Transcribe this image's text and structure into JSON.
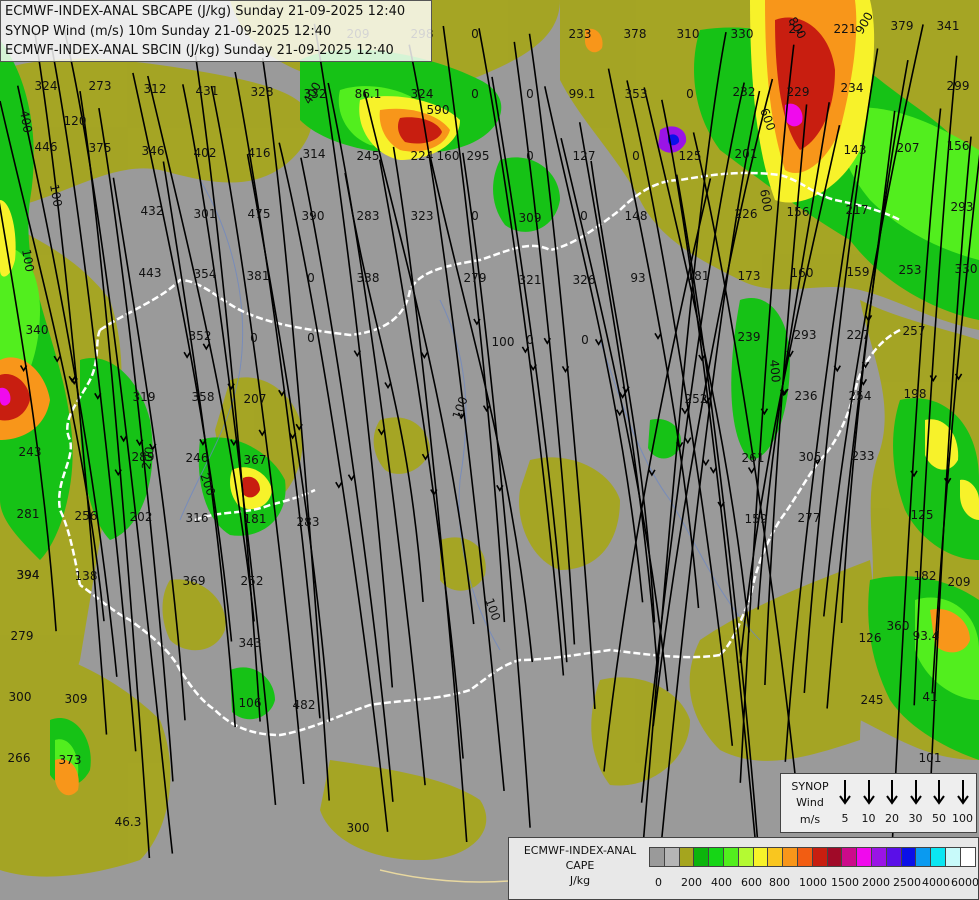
{
  "header": {
    "line1": "ECMWF-INDEX-ANAL SBCAPE (J/kg) Sunday 21-09-2025 12:40",
    "line2": "SYNOP Wind (m/s) 10m Sunday 21-09-2025 12:40",
    "line3": "ECMWF-INDEX-ANAL SBCIN (J/kg) Sunday 21-09-2025 12:40"
  },
  "synop_legend": {
    "title": "SYNOP",
    "subtitle": "Wind",
    "unit": "m/s",
    "speeds": [
      "5",
      "10",
      "20",
      "30",
      "50",
      "100"
    ]
  },
  "cape_legend": {
    "title": "ECMWF-INDEX-ANAL",
    "subtitle": "CAPE",
    "unit": "J/kg",
    "colors": [
      "#9a9a9a",
      "#b5b5b5",
      "#a5a51e",
      "#0cb40c",
      "#16d616",
      "#52ee1e",
      "#b4fa32",
      "#f7f22a",
      "#f9c61f",
      "#f8961a",
      "#f25d12",
      "#c81e10",
      "#a00a28",
      "#cc0a8a",
      "#f00aed",
      "#9a14e6",
      "#5a0fe8",
      "#0a10e8",
      "#0a9af0",
      "#0ae6f2",
      "#c8fafa",
      "#ffffff"
    ],
    "tick_labels": [
      "0",
      "200",
      "400",
      "600",
      "800",
      "1000",
      "1500",
      "2000",
      "2500",
      "4000",
      "6000"
    ]
  },
  "map": {
    "cin_values": [
      "209",
      "298",
      "0",
      "233",
      "378",
      "310",
      "330",
      "22",
      "221",
      "379",
      "341",
      "324",
      "273",
      "312",
      "431",
      "328",
      "332",
      "86.1",
      "324",
      "0",
      "0",
      "99.1",
      "353",
      "0",
      "232",
      "229",
      "234",
      "299",
      "120",
      "590",
      "143",
      "207",
      "156",
      "446",
      "375",
      "346",
      "402",
      "416",
      "314",
      "245",
      "224",
      "160",
      "295",
      "0",
      "127",
      "0",
      "125",
      "201",
      "432",
      "301",
      "475",
      "390",
      "283",
      "323",
      "0",
      "309",
      "0",
      "148",
      "226",
      "156",
      "217",
      "293",
      "354",
      "443",
      "381",
      "0",
      "338",
      "279",
      "321",
      "326",
      "93",
      "181",
      "173",
      "160",
      "159",
      "253",
      "330",
      "340",
      "352",
      "0",
      "0",
      "100",
      "0",
      "0",
      "239",
      "293",
      "227",
      "257",
      "394",
      "319",
      "358",
      "207",
      "252",
      "236",
      "254",
      "198",
      "243",
      "289",
      "246",
      "367",
      "261",
      "305",
      "233",
      "281",
      "256",
      "202",
      "316",
      "181",
      "283",
      "159",
      "277",
      "125",
      "394",
      "138",
      "369",
      "252",
      "182",
      "209",
      "279",
      "343",
      "360",
      "93.4",
      "126",
      "300",
      "309",
      "106",
      "482",
      "245",
      "41",
      "266",
      "373",
      "101",
      "46.3",
      "300"
    ],
    "contour_labels": [
      "100",
      "400",
      "400",
      "200",
      "800",
      "600",
      "600",
      "900",
      "200",
      "100",
      "400",
      "100",
      "100"
    ]
  }
}
